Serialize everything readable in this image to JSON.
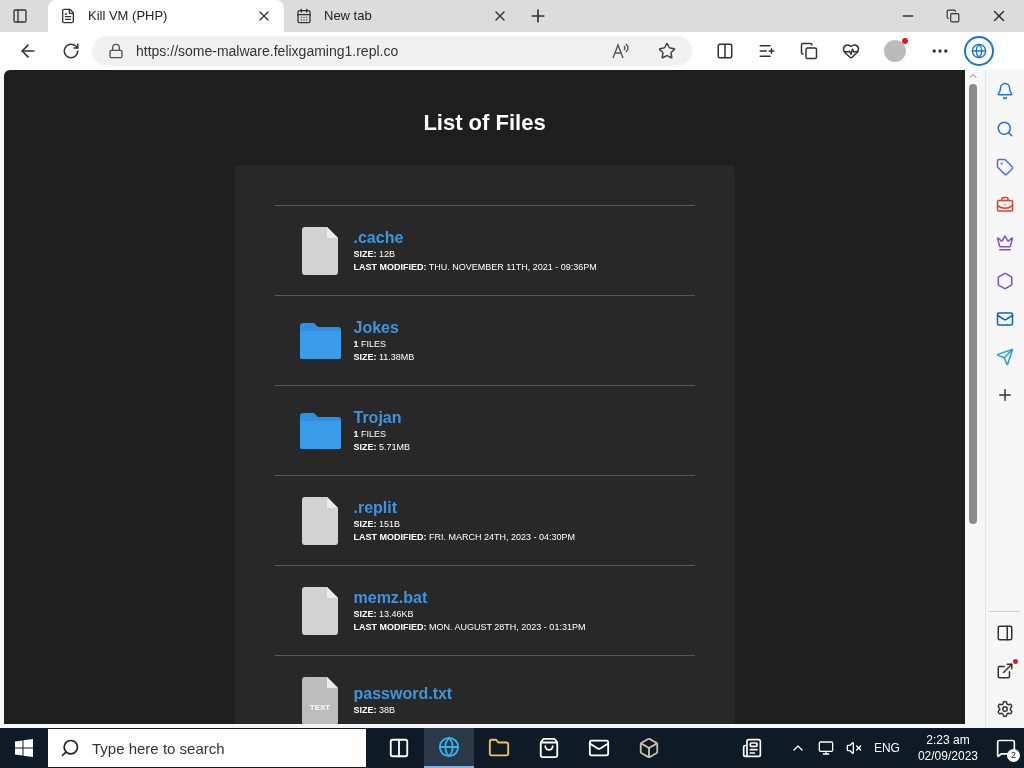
{
  "tabs": [
    {
      "title": "Kill VM (PHP)",
      "kind": "page",
      "selected": true
    },
    {
      "title": "New tab",
      "kind": "newtab",
      "selected": false
    }
  ],
  "address_bar": {
    "url": "https://some-malware.felixgaming1.repl.co"
  },
  "page": {
    "title": "List of Files",
    "items": [
      {
        "kind": "file",
        "name": ".cache",
        "details": [
          "**SIZE:** 12B",
          "**LAST MODIFIED:** THU. NOVEMBER 11TH, 2021 - 09:36PM"
        ]
      },
      {
        "kind": "folder",
        "name": "Jokes",
        "details": [
          "**1** FILES",
          "**SIZE:** 11.38MB"
        ]
      },
      {
        "kind": "folder",
        "name": "Trojan",
        "details": [
          "**1** FILES",
          "**SIZE:** 5.71MB"
        ]
      },
      {
        "kind": "file",
        "name": ".replit",
        "details": [
          "**SIZE:** 151B",
          "**LAST MODIFIED:** FRI. MARCH 24TH, 2023 - 04:30PM"
        ]
      },
      {
        "kind": "file",
        "name": "memz.bat",
        "details": [
          "**SIZE:** 13.46KB",
          "**LAST MODIFIED:** MON. AUGUST 28TH, 2023 - 01:31PM"
        ]
      },
      {
        "kind": "text",
        "icon_label": "TEXT",
        "name": "password.txt",
        "details": [
          "**SIZE:** 38B"
        ]
      }
    ]
  },
  "taskbar": {
    "search": {
      "placeholder": "Type here to search"
    },
    "language": "ENG",
    "time": "2:23 am",
    "date": "02/09/2023",
    "notifications": "2"
  }
}
